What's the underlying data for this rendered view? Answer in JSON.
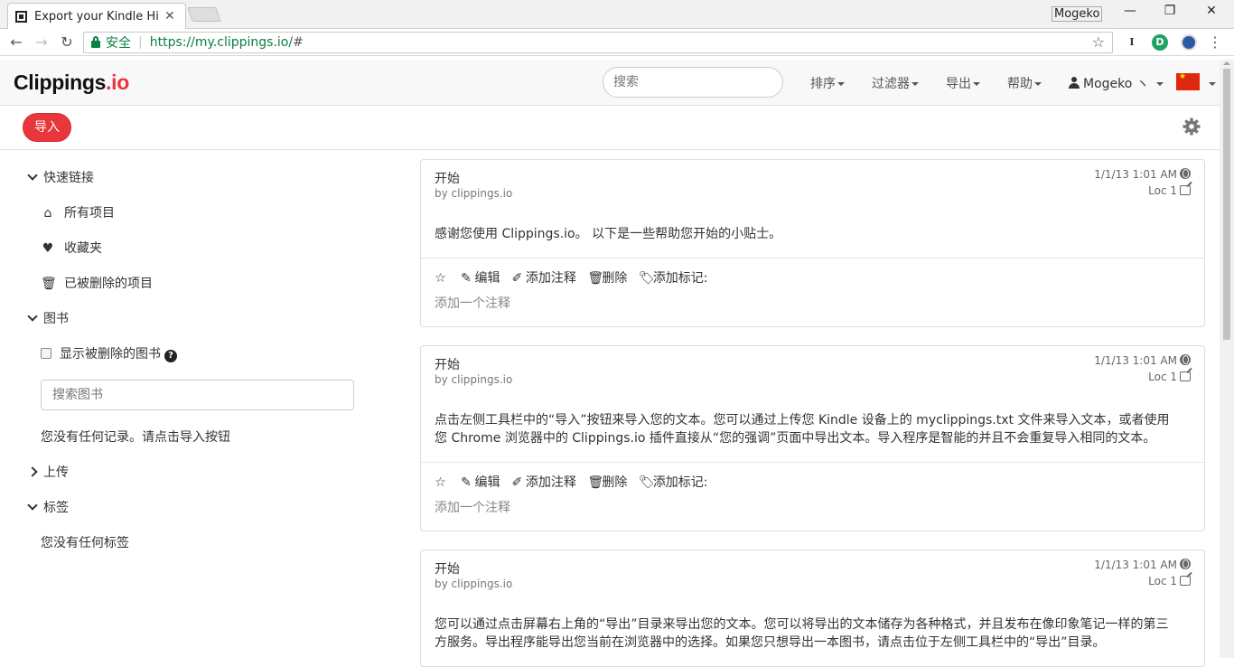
{
  "browser": {
    "tab_title": "Export your Kindle Hig",
    "tab_close": "✕",
    "profile_name": "Mogeko",
    "window_min": "—",
    "window_restore": "❐",
    "window_close": "✕",
    "secure_label": "安全",
    "url_host": "https://my.clippings.io/",
    "url_path": "#",
    "ext_1": "I",
    "ext_2": "D"
  },
  "app": {
    "brand_name": "Clippings",
    "brand_tld": ".io",
    "search_placeholder": "搜索",
    "nav": {
      "sort": "排序",
      "filter": "过滤器",
      "export": "导出",
      "help": "帮助",
      "user": "Mogeko ヽ"
    },
    "import_button": "导入"
  },
  "sidebar": {
    "quick_links": "快速链接",
    "all_items": "所有项目",
    "favorites": "收藏夹",
    "deleted_items": "已被删除的项目",
    "books": "图书",
    "show_deleted_books": "显示被删除的图书",
    "search_books_placeholder": "搜索图书",
    "no_records": "您没有任何记录。请点击导入按钮",
    "upload": "上传",
    "tags": "标签",
    "no_tags": "您没有任何标签"
  },
  "clipping_actions": {
    "edit": "编辑",
    "add_note": "添加注释",
    "delete": "删除",
    "add_tag": "添加标记:",
    "note_placeholder": "添加一个注释"
  },
  "clippings": [
    {
      "title": "开始",
      "author": "by clippings.io",
      "date": "1/1/13 1:01 AM",
      "loc": "Loc 1",
      "text": "感谢您使用 Clippings.io。 以下是一些帮助您开始的小贴士。"
    },
    {
      "title": "开始",
      "author": "by clippings.io",
      "date": "1/1/13 1:01 AM",
      "loc": "Loc 1",
      "text": "点击左侧工具栏中的“导入”按钮来导入您的文本。您可以通过上传您 Kindle 设备上的 myclippings.txt 文件来导入文本，或者使用您 Chrome 浏览器中的 Clippings.io 插件直接从“您的强调”页面中导出文本。导入程序是智能的并且不会重复导入相同的文本。"
    },
    {
      "title": "开始",
      "author": "by clippings.io",
      "date": "1/1/13 1:01 AM",
      "loc": "Loc 1",
      "text": "您可以通过点击屏幕右上角的“导出”目录来导出您的文本。您可以将导出的文本储存为各种格式，并且发布在像印象笔记一样的第三方服务。导出程序能导出您当前在浏览器中的选择。如果您只想导出一本图书，请点击位于左侧工具栏中的“导出”目录。"
    }
  ]
}
